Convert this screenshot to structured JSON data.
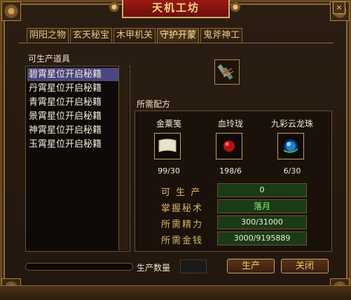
{
  "window": {
    "title": "天机工坊",
    "close_glyph": "×"
  },
  "tabs": [
    {
      "label": "阴阳之物",
      "active": false
    },
    {
      "label": "玄天秘宝",
      "active": false
    },
    {
      "label": "木甲机关",
      "active": false
    },
    {
      "label": "守护开蒙",
      "active": true
    },
    {
      "label": "鬼斧神工",
      "active": false
    }
  ],
  "list": {
    "heading": "可生产道具",
    "items": [
      {
        "label": "碧霄星位开启秘籍",
        "selected": true
      },
      {
        "label": "丹霄星位开启秘籍",
        "selected": false
      },
      {
        "label": "青霄星位开启秘籍",
        "selected": false
      },
      {
        "label": "景霄星位开启秘籍",
        "selected": false
      },
      {
        "label": "神霄星位开启秘籍",
        "selected": false
      },
      {
        "label": "玉霄星位开启秘籍",
        "selected": false
      }
    ]
  },
  "product": {
    "icon": "scroll-bundle-icon"
  },
  "recipe": {
    "heading": "所需配方",
    "materials": [
      {
        "name": "金粟笺",
        "icon": "paper-scroll-icon",
        "count": "99/30"
      },
      {
        "name": "血玲珑",
        "icon": "red-orb-icon",
        "count": "198/6"
      },
      {
        "name": "九彩云龙珠",
        "icon": "blue-dragon-orb-icon",
        "count": "6/30"
      }
    ]
  },
  "stats": {
    "producible_label": "可 生 产",
    "producible_value": "0",
    "skill_label": "掌握秘术",
    "skill_value": "落月",
    "energy_label": "所需精力",
    "energy_value": "300/31000",
    "gold_label": "所需金钱",
    "gold_value": "3000/9195889"
  },
  "footer": {
    "qty_label": "生产数量",
    "produce_button": "生产",
    "close_button": "关闭"
  },
  "colors": {
    "accent_gold": "#d9b56a",
    "selected_row": "#4a4680",
    "field_green": "#1b3a16",
    "highlight_text": "#8ef07a"
  }
}
